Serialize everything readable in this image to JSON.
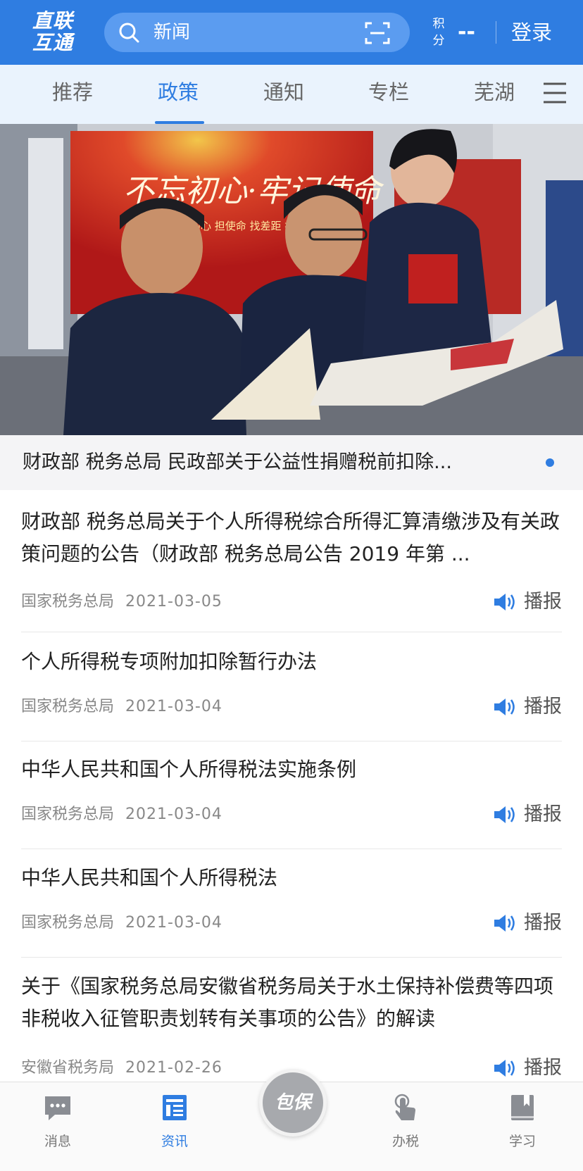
{
  "header": {
    "logo_line1": "直联",
    "logo_line2": "互通",
    "search_placeholder": "新闻",
    "points_label_1": "积",
    "points_label_2": "分",
    "points_value": "--",
    "login_label": "登录"
  },
  "tabs": [
    {
      "label": "推荐"
    },
    {
      "label": "政策"
    },
    {
      "label": "通知"
    },
    {
      "label": "专栏"
    },
    {
      "label": "芜湖"
    }
  ],
  "active_tab": "政策",
  "banner": {
    "slogan": "不忘初心·牢记使命",
    "subtext": "守初心 担使命 找差距 抓落实",
    "caption": "财政部 税务总局 民政部关于公益性捐赠税前扣除..."
  },
  "articles": [
    {
      "title": "财政部 税务总局关于个人所得税综合所得汇算清缴涉及有关政策问题的公告（财政部 税务总局公告 2019 年第 ...",
      "source": "国家税务总局",
      "date": "2021-03-05",
      "action": "播报"
    },
    {
      "title": "个人所得税专项附加扣除暂行办法",
      "source": "国家税务总局",
      "date": "2021-03-04",
      "action": "播报"
    },
    {
      "title": "中华人民共和国个人所得税法实施条例",
      "source": "国家税务总局",
      "date": "2021-03-04",
      "action": "播报"
    },
    {
      "title": "中华人民共和国个人所得税法",
      "source": "国家税务总局",
      "date": "2021-03-04",
      "action": "播报"
    },
    {
      "title": "关于《国家税务总局安徽省税务局关于水土保持补偿费等四项非税收入征管职责划转有关事项的公告》的解读",
      "source": "安徽省税务局",
      "date": "2021-02-26",
      "action": "播报"
    }
  ],
  "bottom_nav": [
    {
      "label": "消息",
      "icon": "chat-bubble-icon"
    },
    {
      "label": "资讯",
      "icon": "news-icon"
    },
    {
      "label": "办税",
      "icon": "tap-hand-icon"
    },
    {
      "label": "学习",
      "icon": "book-icon"
    }
  ],
  "center_button": "包保",
  "colors": {
    "primary": "#2f7de1",
    "tab_bar_bg": "#eaf3fd",
    "text_main": "#222222",
    "text_meta": "#888888"
  }
}
